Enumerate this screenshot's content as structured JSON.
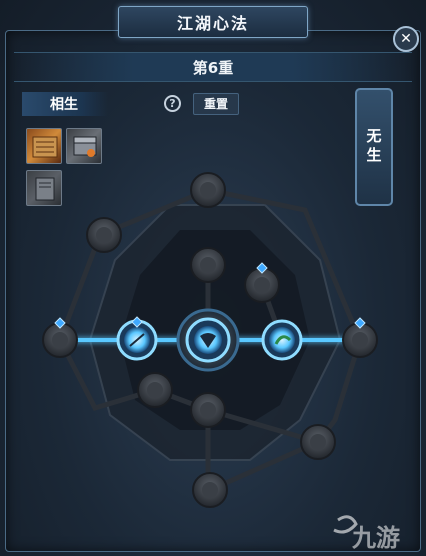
{
  "window": {
    "title": "江湖心法",
    "close_symbol": "✕"
  },
  "level": {
    "label": "第6重"
  },
  "tab": {
    "label": "相生"
  },
  "help": {
    "symbol": "?"
  },
  "reset": {
    "label": "重置"
  },
  "side": {
    "label": "无生"
  },
  "watermark": {
    "text": "九游"
  },
  "colors": {
    "accent": "#7fd4ff",
    "active_path": "#5ac8ff",
    "node_dark": "#3a3f46",
    "marker": "#3fa9ff"
  }
}
